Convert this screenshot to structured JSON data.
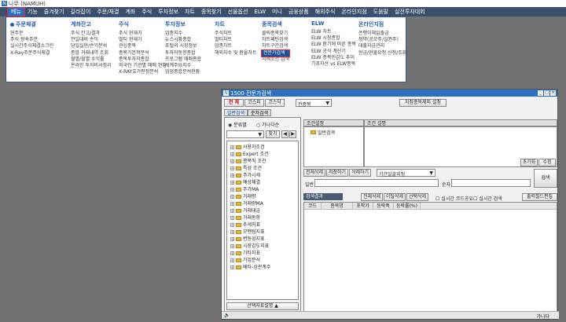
{
  "app": {
    "title": "나무 (NAMUH)",
    "logo": "N"
  },
  "menubar": [
    "메뉴",
    "기능",
    "즐겨찾기",
    "길라잡이",
    "주문/체결",
    "계좌",
    "주식",
    "투자정보",
    "차트",
    "종목찾기",
    "선물옵션",
    "ELW",
    "미니",
    "금융상품",
    "해외주식",
    "온라인지점",
    "도움말",
    "실전투자대회"
  ],
  "mega": {
    "columns": [
      {
        "header": "주문체결",
        "items": [
          "현주문",
          "주식 장속주문",
          "실시간주식체결소크린",
          "X-Ray주문주식체결"
        ],
        "highlight": -1
      },
      {
        "header": "계좌잔고",
        "items": [
          "주식 잔고/결과",
          "전일대비 손익",
          "당일실현/손익분석",
          "종합 거래내역 조회",
          "월별/월별 수익률",
          "온라인 투자비서정리"
        ],
        "highlight": -1
      },
      {
        "header": "주식",
        "items": [
          "주식 현재가",
          "멀티 현재가",
          "관심종목",
          "종목기본적분석",
          "종목투자자종합",
          "외국인 기관별 매매 현황",
          "X-RAY호가판정분석"
        ],
        "highlight": -1
      },
      {
        "header": "투자정보",
        "items": [
          "업종지수",
          "뉴스시황종합",
          "포털의 시장정보",
          "투자자동향종합",
          "프로그램 매매종합",
          "세계주요지수",
          "업업종합분석현황"
        ],
        "highlight": -1
      },
      {
        "header": "차트",
        "items": [
          "주식차트",
          "멀티차트",
          "업종차트",
          "해외지수 및 환율차트"
        ],
        "highlight": -1
      },
      {
        "header": "종목검색",
        "items": [
          "클릭종목찾기",
          "차트패턴검색",
          "차트구간검색",
          "전문가검색",
          "시세조건 검색"
        ],
        "highlight": 3
      },
      {
        "header": "ELW",
        "items": [
          "ELW 차트",
          "ELW 시장종합",
          "ELW 환기에 따른 종목",
          "ELW 공식 계산기",
          "ELW 종목민감도 추이",
          "기초자산 vs ELW종목"
        ],
        "highlight": -1
      },
      {
        "header": "온라인지점",
        "items": [
          "은행이체입출금",
          "청약(공모주/실권주)",
          "대출자금관리",
          "현금/현물요청 신청/조회"
        ],
        "highlight": -1
      }
    ]
  },
  "window": {
    "title": "1500 전문가검색",
    "logo": "N",
    "controls": [
      "_",
      "□",
      "×"
    ],
    "market_tabs": [
      "전 체",
      "코스피",
      "코스닥"
    ],
    "scope_select": "전종목",
    "exclude_button": "지정종목제외 설정",
    "left_tabs": [
      "일반검색",
      "순차검색"
    ],
    "radio": [
      "분류별",
      "가나다순"
    ],
    "search_button": "찾기",
    "tree_items": [
      "사용자조건",
      "Expert 조건",
      "종목직 조건",
      "특성 조건",
      "주가시세",
      "예상체결",
      "주가MA",
      "거래량",
      "거래량MA",
      "거래대금",
      "거래동향",
      "추세지표",
      "모멘텀지표",
      "변동성지표",
      "시장강도지표",
      "기타지표",
      "기업분석",
      "베타-상관계수"
    ],
    "indicator_button": "선택지표설명 ▲",
    "cond_header": "조건설정",
    "cond_desc_header": "조건 설명",
    "cond_item": "일반검색",
    "init_button": "초기화",
    "edit_button": "수정",
    "action_buttons": [
      "전체삭제",
      "저장하기",
      "삭제하기"
    ],
    "sort_select": "기간일괄지정",
    "general_label": "일반",
    "order_label": "순차",
    "search_go": "검색",
    "result_header": "검색결과",
    "result_buttons": [
      "전체삭제",
      "이탈삭제",
      "선택삭제"
    ],
    "check_realtime": "실시간 코드공유",
    "check_search": "실시간 검색",
    "output_button": "출력필드편집",
    "result_cols": [
      "코드",
      "종목명",
      "포착가",
      "등락폭",
      "등락률(%)"
    ],
    "status_right": "가나다"
  }
}
